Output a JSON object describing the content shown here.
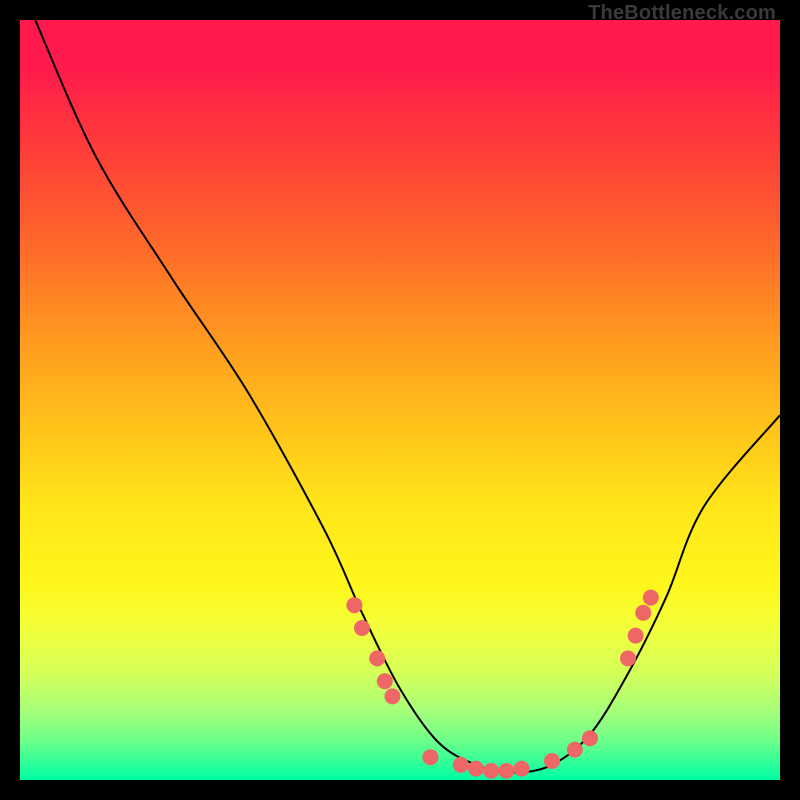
{
  "watermark": "TheBottleneck.com",
  "chart_data": {
    "type": "line",
    "title": "",
    "xlabel": "",
    "ylabel": "",
    "xlim": [
      0,
      100
    ],
    "ylim": [
      0,
      100
    ],
    "grid": false,
    "series": [
      {
        "name": "bottleneck-curve",
        "x": [
          2,
          10,
          20,
          30,
          40,
          45,
          50,
          55,
          60,
          65,
          70,
          75,
          80,
          85,
          90,
          100
        ],
        "y": [
          100,
          82,
          66,
          51,
          33,
          22,
          12,
          5,
          2,
          1,
          2,
          6,
          14,
          24,
          36,
          48
        ]
      }
    ],
    "points": [
      {
        "name": "left-upper-1",
        "x": 44,
        "y": 23
      },
      {
        "name": "left-upper-2",
        "x": 45,
        "y": 20
      },
      {
        "name": "left-upper-3",
        "x": 47,
        "y": 16
      },
      {
        "name": "left-upper-4",
        "x": 48,
        "y": 13
      },
      {
        "name": "left-upper-5",
        "x": 49,
        "y": 11
      },
      {
        "name": "bottom-1",
        "x": 54,
        "y": 3
      },
      {
        "name": "bottom-2",
        "x": 58,
        "y": 2
      },
      {
        "name": "bottom-3",
        "x": 60,
        "y": 1.5
      },
      {
        "name": "bottom-4",
        "x": 62,
        "y": 1.2
      },
      {
        "name": "bottom-5",
        "x": 64,
        "y": 1.2
      },
      {
        "name": "bottom-6",
        "x": 66,
        "y": 1.5
      },
      {
        "name": "bottom-7",
        "x": 70,
        "y": 2.5
      },
      {
        "name": "bottom-8",
        "x": 73,
        "y": 4
      },
      {
        "name": "bottom-9",
        "x": 75,
        "y": 5.5
      },
      {
        "name": "right-upper-1",
        "x": 80,
        "y": 16
      },
      {
        "name": "right-upper-2",
        "x": 81,
        "y": 19
      },
      {
        "name": "right-upper-3",
        "x": 82,
        "y": 22
      },
      {
        "name": "right-upper-4",
        "x": 83,
        "y": 24
      }
    ],
    "gradient_direction": "vertical",
    "gradient_meaning": "red-high-to-green-low"
  }
}
